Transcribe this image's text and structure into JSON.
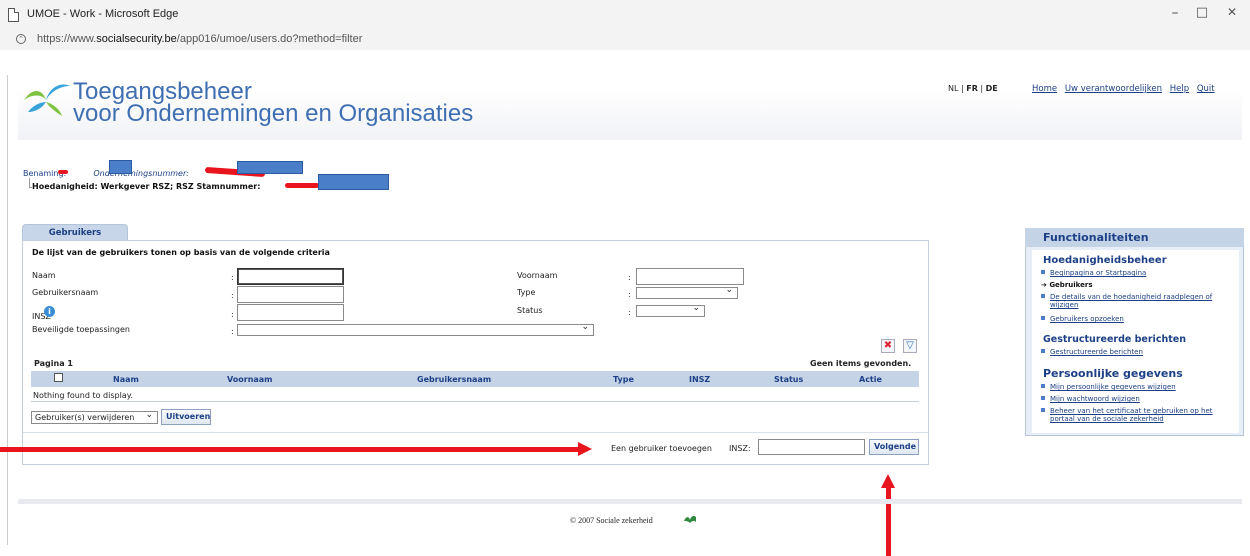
{
  "window": {
    "title": "UMOE - Work - Microsoft Edge",
    "url_prefix": "https://www.",
    "url_domain": "socialsecurity.be",
    "url_path": "/app016/umoe/users.do?method=filter",
    "minimize": "–",
    "maximize": "□",
    "close": "✕"
  },
  "header": {
    "brand_line1": "Toegangsbeheer",
    "brand_line2": "voor Ondernemingen en Organisaties",
    "lang_nl": "NL",
    "lang_sep1": " | ",
    "lang_fr": "FR",
    "lang_sep2": " | ",
    "lang_de": "DE",
    "links": [
      "Home",
      "Uw verantwoordelijken",
      "Help",
      "Quit"
    ]
  },
  "context": {
    "benaming_label": "Benaming:",
    "ondernemingsnummer_label": "Ondernemingsnummer:",
    "hoedanigheid_text": "Hoedanigheid: Werkgever RSZ; RSZ Stamnummer:"
  },
  "tab_label": "Gebruikers",
  "criteria": {
    "title": "De lijst van de gebruikers tonen op basis van de volgende criteria",
    "naam": "Naam",
    "voornaam": "Voornaam",
    "gebruikersnaam": "Gebruikersnaam",
    "type": "Type",
    "insz": "INSZ",
    "status": "Status",
    "beveiligde": "Beveiligde toepassingen",
    "colon": ":"
  },
  "table": {
    "pagina": "Pagina 1",
    "geen_items": "Geen items gevonden.",
    "columns": [
      "Naam",
      "Voornaam",
      "Gebruikersnaam",
      "Type",
      "INSZ",
      "Status",
      "Actie"
    ],
    "empty": "Nothing found to display."
  },
  "actions": {
    "bulk_select": "Gebruiker(s) verwijderen",
    "execute": "Uitvoeren",
    "add_user_label": "Een gebruiker toevoegen",
    "insz_label": "INSZ:",
    "next": "Volgende"
  },
  "sidebar": {
    "title": "Functionaliteiten",
    "section1": "Hoedanigheidsbeheer",
    "s1_items": [
      "Beginpagina or Startpagina",
      "Gebruikers",
      "De details van de hoedanigheid raadplegen of",
      "wijzigen",
      "Gebruikers opzoeken"
    ],
    "section2": "Gestructureerde berichten",
    "s2_items": [
      "Gestructureerde berichten"
    ],
    "section3": "Persoonlijke gegevens",
    "s3_items": [
      "Mijn persoonlijke gegevens wijzigen",
      "Mijn wachtwoord wijzigen",
      "Beheer van het certificaat te gebruiken op het",
      "portaal van de sociale zekerheid"
    ]
  },
  "footer": "© 2007 Sociale zekerheid",
  "colors": {
    "accent_blue": "#1c3f86",
    "arrow_red": "#e8141e",
    "redaction_blue": "#4a7ec9"
  }
}
